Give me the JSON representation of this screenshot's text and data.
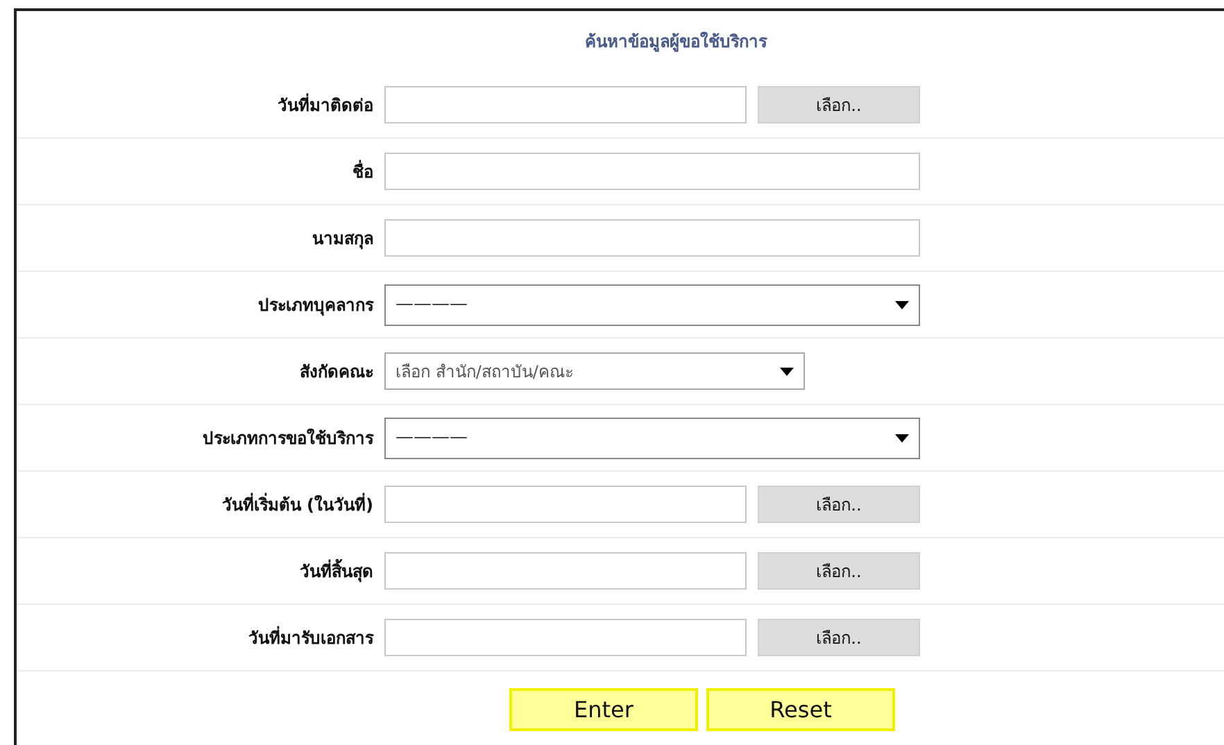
{
  "title": "ค้นหาข้อมูลผู้ขอใช้บริการ",
  "fields": [
    {
      "kind": "date",
      "label": "วันที่มาติดต่อ",
      "button": "เลือก.."
    },
    {
      "kind": "text",
      "label": "ชื่อ"
    },
    {
      "kind": "text",
      "label": "นามสกุล"
    },
    {
      "kind": "select",
      "label": "ประเภทบุคลากร",
      "value": "————"
    },
    {
      "kind": "select-short",
      "label": "สังกัดคณะ",
      "value": "เลือก สำนัก/สถาบัน/คณะ"
    },
    {
      "kind": "select",
      "label": "ประเภทการขอใช้บริการ",
      "value": "————"
    },
    {
      "kind": "date",
      "label": "วันที่เริ่มต้น (ในวันที่)",
      "button": "เลือก.."
    },
    {
      "kind": "date",
      "label": "วันที่สิ้นสุด",
      "button": "เลือก.."
    },
    {
      "kind": "date",
      "label": "วันที่มารับเอกสาร",
      "button": "เลือก.."
    }
  ],
  "buttons": [
    "Enter",
    "Reset"
  ]
}
